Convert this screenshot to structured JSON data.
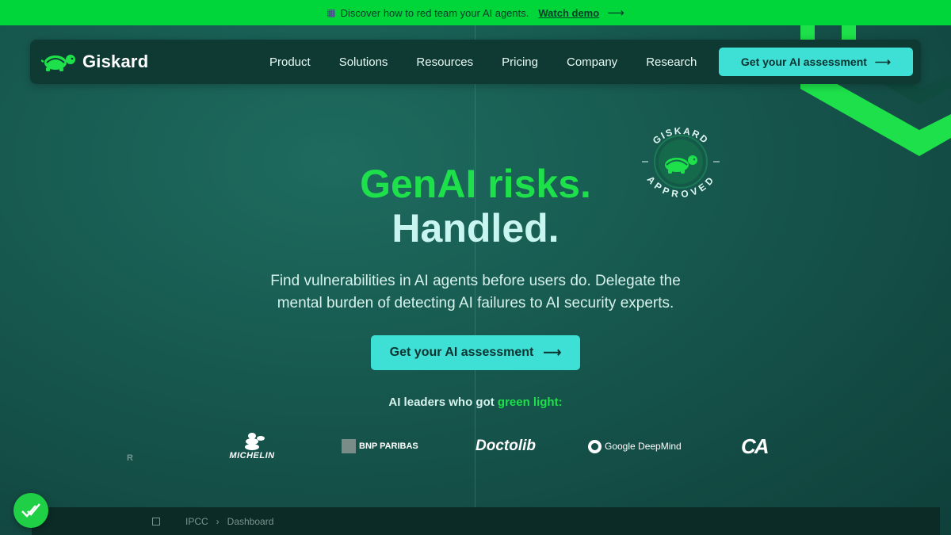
{
  "banner": {
    "text": "Discover how to red team your AI agents.",
    "link_label": "Watch demo",
    "arrow": "⟶"
  },
  "nav": {
    "brand": "Giskard",
    "links": [
      "Product",
      "Solutions",
      "Resources",
      "Pricing",
      "Company",
      "Research"
    ],
    "cta_label": "Get your AI assessment",
    "cta_arrow": "⟶"
  },
  "badge": {
    "top_text": "GISKARD",
    "bottom_text": "APPROVED"
  },
  "hero": {
    "headline_1": "GenAI risks.",
    "headline_2": "Handled.",
    "subtitle_1": "Find vulnerabilities in AI agents before users do. Delegate the",
    "subtitle_2": "mental burden of detecting AI failures to AI security experts.",
    "cta_label": "Get your AI assessment",
    "cta_arrow": "⟶"
  },
  "leaders": {
    "prefix": "AI leaders who got",
    "highlight": "green light:"
  },
  "logos": {
    "partial": "R",
    "michelin": "MICHELIN",
    "bnp": "BNP PARIBAS",
    "doctolib": "Doctolib",
    "deepmind": "Google DeepMind",
    "ca": "CA"
  },
  "bottom_bar": {
    "crumb_1": "IPCC",
    "separator": "›",
    "crumb_2": "Dashboard"
  },
  "colors": {
    "banner_green": "#00d639",
    "accent_cyan": "#3ee0d6",
    "headline_green": "#1de04a",
    "navbar_bg": "#0f3a34"
  },
  "icons": {
    "banner": "calendar-icon",
    "brand": "turtle-logo-icon",
    "fab": "check-icon"
  }
}
